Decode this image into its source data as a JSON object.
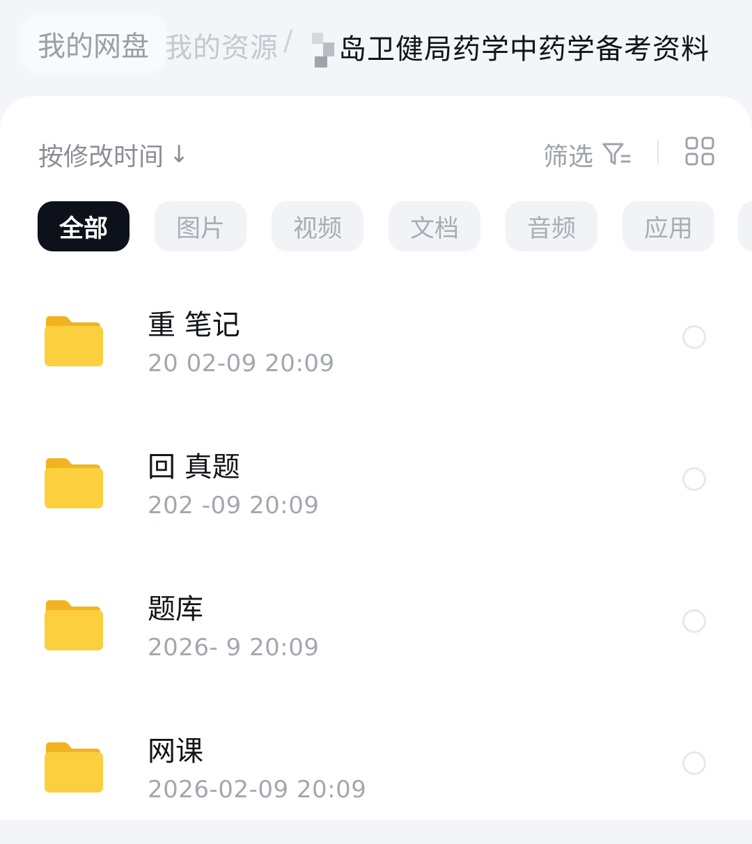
{
  "breadcrumb": {
    "root": "我的网盘",
    "middle": "我的资源",
    "separator": "/",
    "current": "岛卫健局药学中药学备考资料"
  },
  "toolbar": {
    "sort_label": "按修改时间",
    "sort_arrow": "↓",
    "filter_label": "筛选",
    "filter_icon": "filter-icon",
    "view_icon": "grid-view-icon"
  },
  "categories": [
    {
      "label": "全部",
      "active": true
    },
    {
      "label": "图片",
      "active": false
    },
    {
      "label": "视频",
      "active": false
    },
    {
      "label": "文档",
      "active": false
    },
    {
      "label": "音频",
      "active": false
    },
    {
      "label": "应用",
      "active": false
    }
  ],
  "files": [
    {
      "name": "重  笔记",
      "date": "20  02-09  20:09",
      "icon": "folder-icon"
    },
    {
      "name": "回  真题",
      "date": "202  -09  20:09",
      "icon": "folder-icon"
    },
    {
      "name": "题库",
      "date": "2026-  9  20:09",
      "icon": "folder-icon"
    },
    {
      "name": "网课",
      "date": "2026-02-09  20:09",
      "icon": "folder-icon"
    }
  ],
  "colors": {
    "folder": "#f8c52f",
    "chip_active": "#0d111a",
    "chip_inactive": "#f1f3f6"
  }
}
